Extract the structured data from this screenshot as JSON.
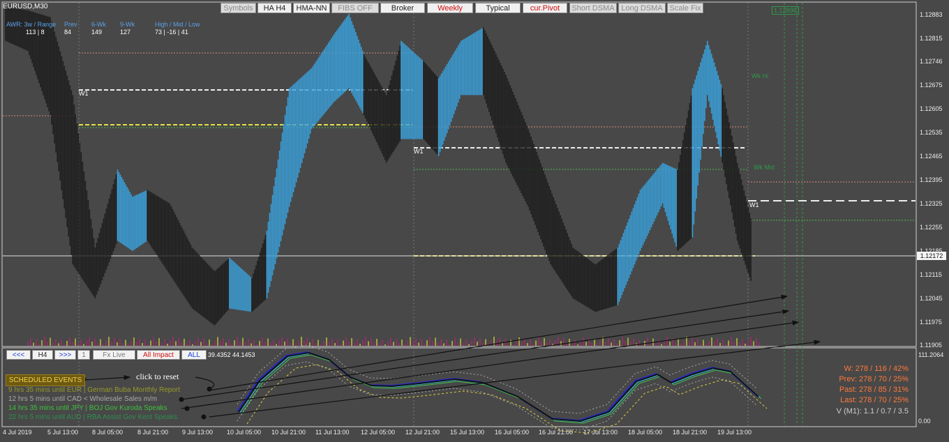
{
  "window": {
    "title": "EURUSD,M30"
  },
  "toolbar": [
    {
      "label": "Symbols",
      "state": "off"
    },
    {
      "label": "HA H4",
      "state": "on"
    },
    {
      "label": "HMA-NN",
      "state": "on"
    },
    {
      "label": "FIBS OFF",
      "state": "off"
    },
    {
      "label": "Broker",
      "state": "on"
    },
    {
      "label": "Weekly",
      "state": "red"
    },
    {
      "label": "Typical",
      "state": "on"
    },
    {
      "label": "cur.Pivot",
      "state": "red"
    },
    {
      "label": "Short DSMA",
      "state": "off"
    },
    {
      "label": "Long DSMA",
      "state": "off"
    },
    {
      "label": "Scale Fix",
      "state": "off"
    }
  ],
  "info_panel": {
    "labels": [
      "AWR: 3w / Range",
      "Prev",
      "6-Wk",
      "9-Wk",
      "High / Mid / Low"
    ],
    "values": [
      "113 | 8",
      "84",
      "149",
      "127",
      "73  |  -16  |  41"
    ]
  },
  "nav_buttons": [
    {
      "label": "<<<",
      "style": "blue"
    },
    {
      "label": "H4",
      "style": "normal"
    },
    {
      "label": ">>>",
      "style": "blue"
    },
    {
      "label": "1",
      "style": "grey"
    },
    {
      "label": "Fx Live",
      "style": "grey"
    },
    {
      "label": "All Impact",
      "style": "red"
    },
    {
      "label": "ALL",
      "style": "blue"
    }
  ],
  "oscillator_values": "39.4352 44.1453",
  "scheduled_events": {
    "title": "SCHEDULED EVENTS",
    "reset_label": "click to reset",
    "items": [
      {
        "text": "9 hrs 35 mins until EUR  |  German Buba Monthly Report",
        "color": "#9a9a2a"
      },
      {
        "text": "12 hrs 5 mins until CAD  <  Wholesale Sales m/m",
        "color": "#a8a8a8"
      },
      {
        "text": "14 hrs 35 mins until JPY  |  BOJ Gov Kuroda Speaks",
        "color": "#3ec13e"
      },
      {
        "text": "22 hrs 5 mins until AUD  |  RBA Assist Gov Kent Speaks",
        "color": "#2f8f4f"
      }
    ]
  },
  "stats": [
    "W: 278 / 116 / 42%",
    "Prev: 278 / 70 / 25%",
    "Past: 278 / 85 / 31%",
    "Last: 278 / 70 / 25%"
  ],
  "volatility": "V (M1): 1.1 / 0.7 / 3.5",
  "chart_labels": {
    "w1": "W1",
    "wk_hi": "Wk Hi",
    "wk_mid": "Wk Mid",
    "price_box": "1.12898",
    "current_price": "1.12172",
    "osc_top": "111.2064",
    "osc_bottom": "0.00"
  },
  "chart_data": {
    "type": "candlestick",
    "symbol": "EURUSD",
    "timeframe": "M30",
    "ylim": [
      1.119,
      1.129
    ],
    "y_ticks": [
      "1.12883",
      "1.12815",
      "1.12746",
      "1.12675",
      "1.12605",
      "1.12535",
      "1.12465",
      "1.12395",
      "1.12325",
      "1.12255",
      "1.12185",
      "1.12115",
      "1.12045",
      "1.11975",
      "1.11905"
    ],
    "x_ticks": [
      "4 Jul 2019",
      "5 Jul 13:00",
      "8 Jul 05:00",
      "8 Jul 21:00",
      "9 Jul 13:00",
      "10 Jul 05:00",
      "10 Jul 21:00",
      "11 Jul 13:00",
      "12 Jul 05:00",
      "12 Jul 21:00",
      "15 Jul 13:00",
      "16 Jul 05:00",
      "16 Jul 21:00",
      "17 Jul 13:00",
      "18 Jul 05:00",
      "18 Jul 21:00",
      "19 Jul 13:00"
    ],
    "current_price": 1.12172,
    "heikin_ashi_band": [
      {
        "i": 0,
        "o": 1.1286,
        "c": 1.1284,
        "up": false
      },
      {
        "i": 3,
        "o": 1.1285,
        "c": 1.1281,
        "up": false
      },
      {
        "i": 6,
        "o": 1.1283,
        "c": 1.1262,
        "up": false
      },
      {
        "i": 9,
        "o": 1.126,
        "c": 1.1218,
        "up": false
      },
      {
        "i": 12,
        "o": 1.1215,
        "c": 1.1208,
        "up": false
      },
      {
        "i": 15,
        "o": 1.1225,
        "c": 1.1238,
        "up": true
      },
      {
        "i": 17,
        "o": 1.123,
        "c": 1.1222,
        "up": true
      },
      {
        "i": 19,
        "o": 1.1232,
        "c": 1.1225,
        "up": false
      },
      {
        "i": 22,
        "o": 1.1228,
        "c": 1.1215,
        "up": false
      },
      {
        "i": 25,
        "o": 1.1215,
        "c": 1.1205,
        "up": false
      },
      {
        "i": 28,
        "o": 1.1208,
        "c": 1.12,
        "up": false
      },
      {
        "i": 30,
        "o": 1.1205,
        "c": 1.1212,
        "up": true
      },
      {
        "i": 33,
        "o": 1.1206,
        "c": 1.1204,
        "up": false
      },
      {
        "i": 35,
        "o": 1.1208,
        "c": 1.122,
        "up": true
      },
      {
        "i": 38,
        "o": 1.1235,
        "c": 1.1262,
        "up": true
      },
      {
        "i": 41,
        "o": 1.1258,
        "c": 1.1268,
        "up": true
      },
      {
        "i": 44,
        "o": 1.1266,
        "c": 1.1278,
        "up": true
      },
      {
        "i": 46,
        "o": 1.127,
        "c": 1.1284,
        "up": true
      },
      {
        "i": 48,
        "o": 1.1272,
        "c": 1.1262,
        "up": false
      },
      {
        "i": 51,
        "o": 1.126,
        "c": 1.1248,
        "up": false
      },
      {
        "i": 53,
        "o": 1.1255,
        "c": 1.1276,
        "up": true
      },
      {
        "i": 56,
        "o": 1.127,
        "c": 1.1255,
        "up": false
      },
      {
        "i": 58,
        "o": 1.125,
        "c": 1.1265,
        "up": true
      },
      {
        "i": 61,
        "o": 1.1268,
        "c": 1.1276,
        "up": true
      },
      {
        "i": 64,
        "o": 1.128,
        "c": 1.1268,
        "up": false
      },
      {
        "i": 67,
        "o": 1.1266,
        "c": 1.1248,
        "up": false
      },
      {
        "i": 70,
        "o": 1.125,
        "c": 1.1235,
        "up": false
      },
      {
        "i": 73,
        "o": 1.1232,
        "c": 1.1218,
        "up": false
      },
      {
        "i": 76,
        "o": 1.1215,
        "c": 1.1208,
        "up": false
      },
      {
        "i": 79,
        "o": 1.121,
        "c": 1.1204,
        "up": false
      },
      {
        "i": 82,
        "o": 1.1206,
        "c": 1.1215,
        "up": true
      },
      {
        "i": 85,
        "o": 1.1222,
        "c": 1.1232,
        "up": true
      },
      {
        "i": 88,
        "o": 1.1236,
        "c": 1.124,
        "up": true
      },
      {
        "i": 90,
        "o": 1.1238,
        "c": 1.1222,
        "up": false
      },
      {
        "i": 92,
        "o": 1.1226,
        "c": 1.1262,
        "up": true
      },
      {
        "i": 94,
        "o": 1.1268,
        "c": 1.1276,
        "up": true
      },
      {
        "i": 96,
        "o": 1.1262,
        "c": 1.1248,
        "up": false
      },
      {
        "i": 98,
        "o": 1.124,
        "c": 1.1225,
        "up": false
      },
      {
        "i": 100,
        "o": 1.1222,
        "c": 1.1212,
        "up": false
      }
    ]
  }
}
